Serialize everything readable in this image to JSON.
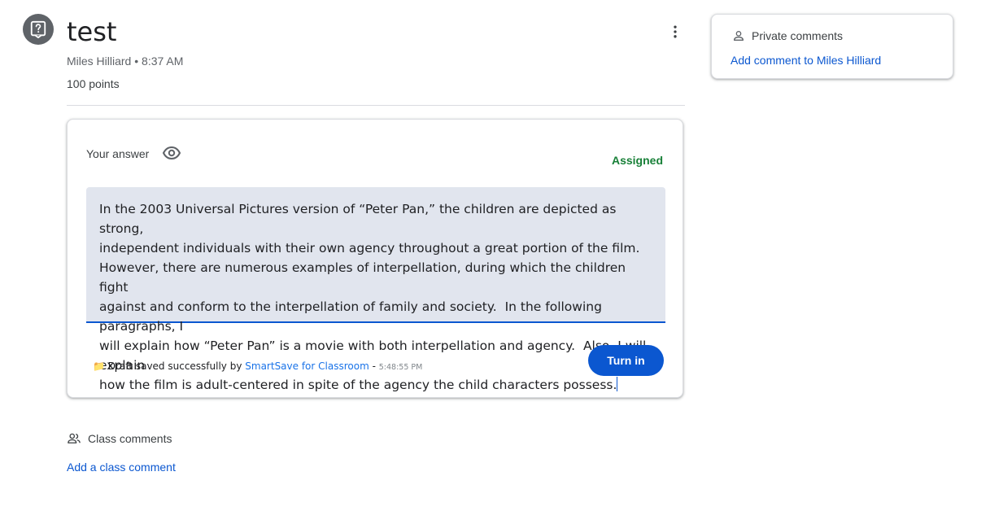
{
  "assignment": {
    "title": "test",
    "author": "Miles Hilliard",
    "separator": " • ",
    "time": "8:37 AM",
    "points": "100 points"
  },
  "answer_card": {
    "label": "Your answer",
    "status": "Assigned",
    "answer_text": "In the 2003 Universal Pictures version of “Peter Pan,” the children are depicted as strong,\nindependent individuals with their own agency throughout a great portion of the film.\nHowever, there are numerous examples of interpellation, during which the children fight\nagainst and conform to the interpellation of family and society.  In the following paragraphs, I\nwill explain how “Peter Pan” is a movie with both interpellation and agency.  Also, I will explain\nhow the film is adult-centered in spite of the agency the child characters possess.",
    "draft_icon": "📁",
    "draft_prefix": "Draft saved successfully by",
    "draft_link": "SmartSave for Classroom",
    "draft_dash": "-",
    "draft_time": "5:48:55 PM",
    "turn_in_label": "Turn in"
  },
  "class_comments": {
    "title": "Class comments",
    "add_label": "Add a class comment"
  },
  "private_comments": {
    "title": "Private comments",
    "add_label": "Add comment to Miles Hilliard"
  },
  "icons": {
    "assignment": "question-assignment-icon",
    "more": "more-vert-icon",
    "visibility": "eye-icon",
    "class_comments": "people-icon",
    "private_comments": "person-icon"
  },
  "colors": {
    "accent": "#0b57d0",
    "status_assigned": "#188038",
    "answer_background": "#e1e5ee"
  }
}
